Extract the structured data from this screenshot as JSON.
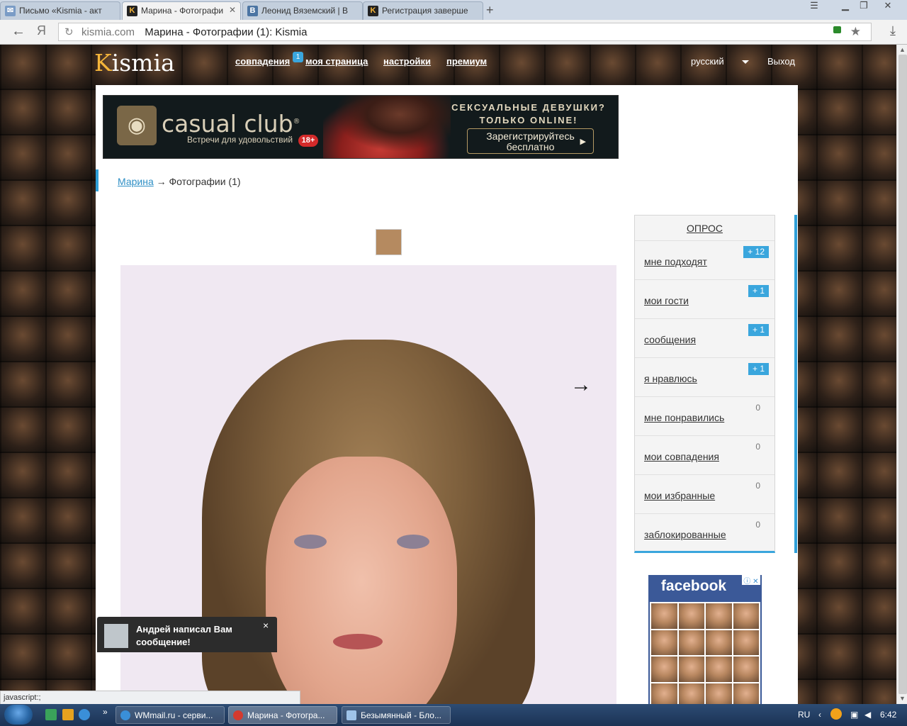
{
  "browser": {
    "tabs": [
      {
        "title": "Письмо «Kismia - акт",
        "icon": "mail-icon"
      },
      {
        "title": "Марина - Фотографи",
        "icon": "kismia-icon",
        "active": true
      },
      {
        "title": "Леонид Вяземский | В",
        "icon": "vk-icon"
      },
      {
        "title": "Регистрация заверше",
        "icon": "kismia-icon"
      }
    ],
    "new_tab": "+",
    "back": "←",
    "yandex": "Я",
    "reload": "↻",
    "domain": "kismia.com",
    "page_title": "Марина - Фотографии (1): Kismia",
    "star": "★",
    "download": "⤓",
    "status_text": "javascript:;"
  },
  "site": {
    "logo_k": "K",
    "logo_rest": "ismia",
    "nav": {
      "matches": "совпадения",
      "matches_badge": "1",
      "my_page": "моя страница",
      "settings": "настройки",
      "premium": "премиум"
    },
    "language": "русский",
    "logout": "Выход"
  },
  "banner": {
    "brand": "casual club",
    "reg_mark": "®",
    "tagline": "Встречи для удовольствий",
    "age": "18+",
    "slogan_line1": "СЕКСУАЛЬНЫЕ ДЕВУШКИ?",
    "slogan_line2": "ТОЛЬКО ONLINE!",
    "button_line1": "Зарегистрируйтесь",
    "button_line2": "бесплатно"
  },
  "breadcrumb": {
    "link": "Марина",
    "separator": "→",
    "current": "Фотографии (1)"
  },
  "photo": {
    "next_arrow": "→"
  },
  "sidebar": {
    "title": "ОПРОС",
    "items": [
      {
        "label": "мне подходят",
        "count": "+ 12"
      },
      {
        "label": "мои гости",
        "count": "+ 1"
      },
      {
        "label": "сообщения",
        "count": "+ 1"
      },
      {
        "label": "я нравлюсь",
        "count": "+ 1"
      },
      {
        "label": "мне понравились",
        "count": "0"
      },
      {
        "label": "мои совпадения",
        "count": "0"
      },
      {
        "label": "мои избранные",
        "count": "0"
      },
      {
        "label": "заблокированные",
        "count": "0"
      }
    ]
  },
  "ad": {
    "brand": "facebook",
    "ad_icons": "ⓘ ✕"
  },
  "toast": {
    "line1": "Андрей написал Вам",
    "line2": "сообщение!",
    "close": "×"
  },
  "taskbar": {
    "tasks": [
      {
        "label": "WMmail.ru - серви..."
      },
      {
        "label": "Марина - Фотогра...",
        "active": true
      },
      {
        "label": "Безымянный - Бло..."
      }
    ],
    "more": "»",
    "lang": "RU",
    "time": "6:42"
  }
}
